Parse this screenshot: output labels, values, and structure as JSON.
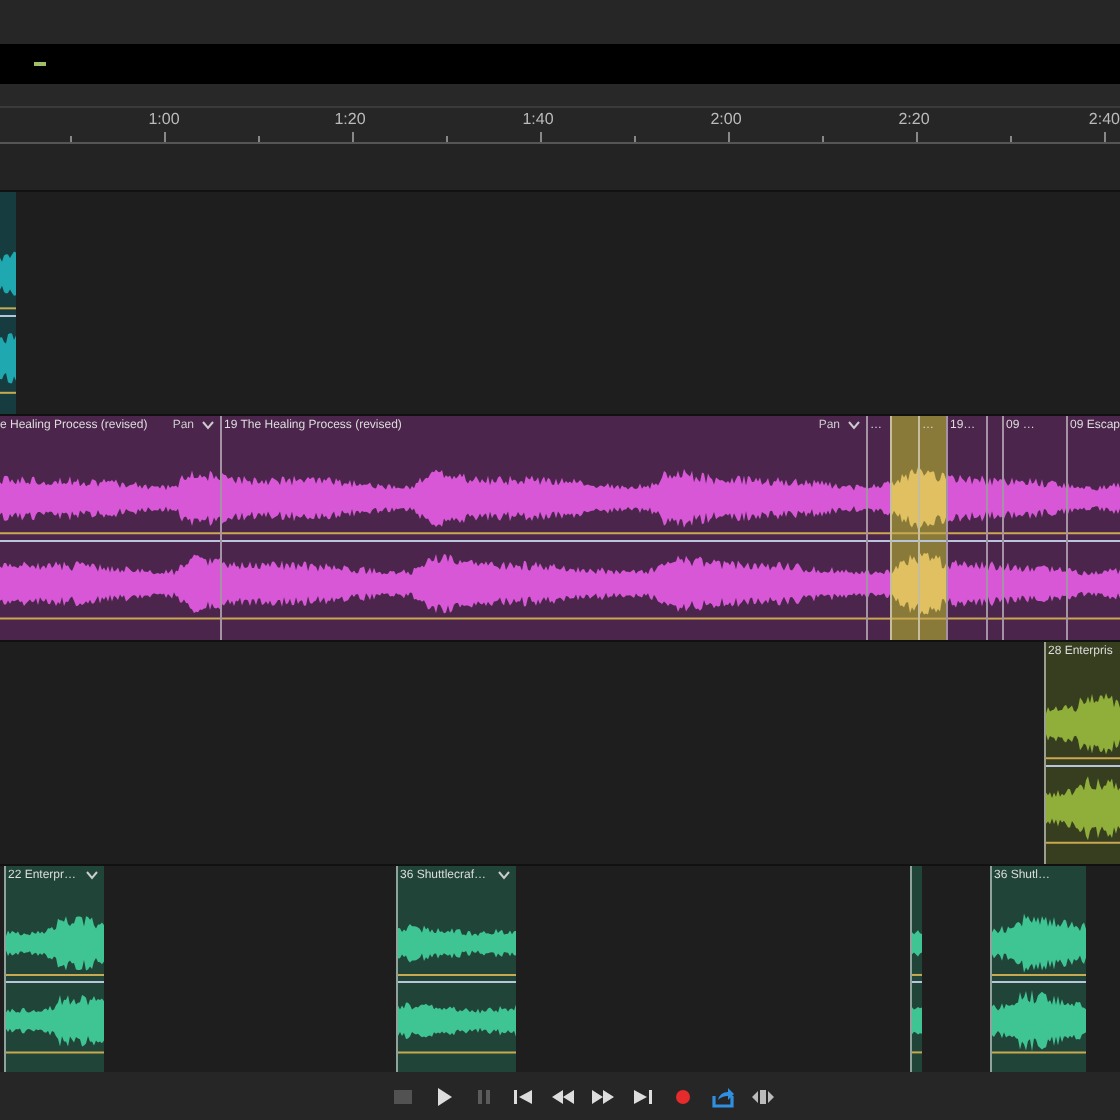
{
  "ruler": {
    "labels": [
      "1:00",
      "1:20",
      "1:40",
      "2:00",
      "2:20",
      "2:40"
    ]
  },
  "tracks": [
    {
      "color": "#1fa8b0",
      "clips": [
        {
          "selected": false
        }
      ]
    },
    {
      "color": "#d757d7",
      "clips": [
        {
          "label": "e Healing Process (revised)",
          "pan": "Pan",
          "selected": false
        },
        {
          "label": "19 The Healing Process (revised)",
          "pan": "Pan",
          "selected": false
        },
        {
          "label": "…",
          "selected": false
        },
        {
          "selected": true
        },
        {
          "label": "…",
          "selected": true
        },
        {
          "label": "19…",
          "selected": false
        },
        {
          "selected": false
        },
        {
          "label": "09 …",
          "selected": false
        },
        {
          "label": "09 Escap",
          "selected": false
        }
      ]
    },
    {
      "color": "#8fae3a",
      "clips": [
        {
          "label": "28 Enterpris",
          "selected": false
        }
      ]
    },
    {
      "color": "#3fc594",
      "clips": [
        {
          "label": "22 Enterpr…",
          "selected": false
        },
        {
          "label": "36 Shuttlecraf…",
          "selected": false
        },
        {
          "selected": false
        },
        {
          "label": "36 Shutl…",
          "selected": false
        }
      ]
    }
  ],
  "transport": [
    {
      "kind": "stop",
      "disabled": true
    },
    {
      "kind": "play",
      "disabled": false
    },
    {
      "kind": "pause",
      "disabled": true
    },
    {
      "kind": "to-start",
      "disabled": false
    },
    {
      "kind": "rewind",
      "disabled": false
    },
    {
      "kind": "forward",
      "disabled": false
    },
    {
      "kind": "to-end",
      "disabled": false
    },
    {
      "kind": "record",
      "disabled": false
    },
    {
      "kind": "loop",
      "disabled": false
    },
    {
      "kind": "skip",
      "disabled": false
    }
  ]
}
